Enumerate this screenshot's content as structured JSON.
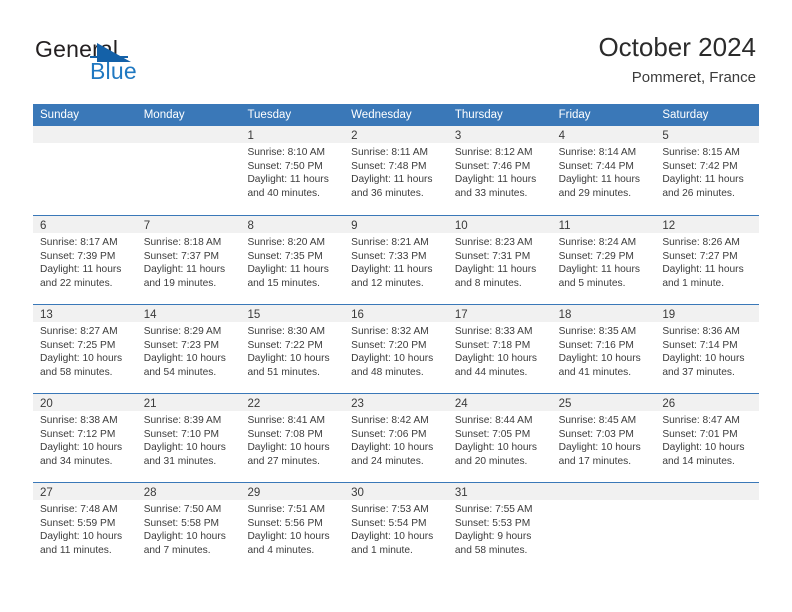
{
  "brand": {
    "name_part1": "General",
    "name_part2": "Blue",
    "accent_color": "#1f78c1",
    "triangle_color": "#1461a8"
  },
  "header": {
    "title": "October 2024",
    "subtitle": "Pommeret, France"
  },
  "calendar": {
    "header_bg": "#3a78b8",
    "weekdays": [
      "Sunday",
      "Monday",
      "Tuesday",
      "Wednesday",
      "Thursday",
      "Friday",
      "Saturday"
    ],
    "weeks": [
      [
        {
          "day": "",
          "lines": []
        },
        {
          "day": "",
          "lines": []
        },
        {
          "day": "1",
          "lines": [
            "Sunrise: 8:10 AM",
            "Sunset: 7:50 PM",
            "Daylight: 11 hours",
            "and 40 minutes."
          ]
        },
        {
          "day": "2",
          "lines": [
            "Sunrise: 8:11 AM",
            "Sunset: 7:48 PM",
            "Daylight: 11 hours",
            "and 36 minutes."
          ]
        },
        {
          "day": "3",
          "lines": [
            "Sunrise: 8:12 AM",
            "Sunset: 7:46 PM",
            "Daylight: 11 hours",
            "and 33 minutes."
          ]
        },
        {
          "day": "4",
          "lines": [
            "Sunrise: 8:14 AM",
            "Sunset: 7:44 PM",
            "Daylight: 11 hours",
            "and 29 minutes."
          ]
        },
        {
          "day": "5",
          "lines": [
            "Sunrise: 8:15 AM",
            "Sunset: 7:42 PM",
            "Daylight: 11 hours",
            "and 26 minutes."
          ]
        }
      ],
      [
        {
          "day": "6",
          "lines": [
            "Sunrise: 8:17 AM",
            "Sunset: 7:39 PM",
            "Daylight: 11 hours",
            "and 22 minutes."
          ]
        },
        {
          "day": "7",
          "lines": [
            "Sunrise: 8:18 AM",
            "Sunset: 7:37 PM",
            "Daylight: 11 hours",
            "and 19 minutes."
          ]
        },
        {
          "day": "8",
          "lines": [
            "Sunrise: 8:20 AM",
            "Sunset: 7:35 PM",
            "Daylight: 11 hours",
            "and 15 minutes."
          ]
        },
        {
          "day": "9",
          "lines": [
            "Sunrise: 8:21 AM",
            "Sunset: 7:33 PM",
            "Daylight: 11 hours",
            "and 12 minutes."
          ]
        },
        {
          "day": "10",
          "lines": [
            "Sunrise: 8:23 AM",
            "Sunset: 7:31 PM",
            "Daylight: 11 hours",
            "and 8 minutes."
          ]
        },
        {
          "day": "11",
          "lines": [
            "Sunrise: 8:24 AM",
            "Sunset: 7:29 PM",
            "Daylight: 11 hours",
            "and 5 minutes."
          ]
        },
        {
          "day": "12",
          "lines": [
            "Sunrise: 8:26 AM",
            "Sunset: 7:27 PM",
            "Daylight: 11 hours",
            "and 1 minute."
          ]
        }
      ],
      [
        {
          "day": "13",
          "lines": [
            "Sunrise: 8:27 AM",
            "Sunset: 7:25 PM",
            "Daylight: 10 hours",
            "and 58 minutes."
          ]
        },
        {
          "day": "14",
          "lines": [
            "Sunrise: 8:29 AM",
            "Sunset: 7:23 PM",
            "Daylight: 10 hours",
            "and 54 minutes."
          ]
        },
        {
          "day": "15",
          "lines": [
            "Sunrise: 8:30 AM",
            "Sunset: 7:22 PM",
            "Daylight: 10 hours",
            "and 51 minutes."
          ]
        },
        {
          "day": "16",
          "lines": [
            "Sunrise: 8:32 AM",
            "Sunset: 7:20 PM",
            "Daylight: 10 hours",
            "and 48 minutes."
          ]
        },
        {
          "day": "17",
          "lines": [
            "Sunrise: 8:33 AM",
            "Sunset: 7:18 PM",
            "Daylight: 10 hours",
            "and 44 minutes."
          ]
        },
        {
          "day": "18",
          "lines": [
            "Sunrise: 8:35 AM",
            "Sunset: 7:16 PM",
            "Daylight: 10 hours",
            "and 41 minutes."
          ]
        },
        {
          "day": "19",
          "lines": [
            "Sunrise: 8:36 AM",
            "Sunset: 7:14 PM",
            "Daylight: 10 hours",
            "and 37 minutes."
          ]
        }
      ],
      [
        {
          "day": "20",
          "lines": [
            "Sunrise: 8:38 AM",
            "Sunset: 7:12 PM",
            "Daylight: 10 hours",
            "and 34 minutes."
          ]
        },
        {
          "day": "21",
          "lines": [
            "Sunrise: 8:39 AM",
            "Sunset: 7:10 PM",
            "Daylight: 10 hours",
            "and 31 minutes."
          ]
        },
        {
          "day": "22",
          "lines": [
            "Sunrise: 8:41 AM",
            "Sunset: 7:08 PM",
            "Daylight: 10 hours",
            "and 27 minutes."
          ]
        },
        {
          "day": "23",
          "lines": [
            "Sunrise: 8:42 AM",
            "Sunset: 7:06 PM",
            "Daylight: 10 hours",
            "and 24 minutes."
          ]
        },
        {
          "day": "24",
          "lines": [
            "Sunrise: 8:44 AM",
            "Sunset: 7:05 PM",
            "Daylight: 10 hours",
            "and 20 minutes."
          ]
        },
        {
          "day": "25",
          "lines": [
            "Sunrise: 8:45 AM",
            "Sunset: 7:03 PM",
            "Daylight: 10 hours",
            "and 17 minutes."
          ]
        },
        {
          "day": "26",
          "lines": [
            "Sunrise: 8:47 AM",
            "Sunset: 7:01 PM",
            "Daylight: 10 hours",
            "and 14 minutes."
          ]
        }
      ],
      [
        {
          "day": "27",
          "lines": [
            "Sunrise: 7:48 AM",
            "Sunset: 5:59 PM",
            "Daylight: 10 hours",
            "and 11 minutes."
          ]
        },
        {
          "day": "28",
          "lines": [
            "Sunrise: 7:50 AM",
            "Sunset: 5:58 PM",
            "Daylight: 10 hours",
            "and 7 minutes."
          ]
        },
        {
          "day": "29",
          "lines": [
            "Sunrise: 7:51 AM",
            "Sunset: 5:56 PM",
            "Daylight: 10 hours",
            "and 4 minutes."
          ]
        },
        {
          "day": "30",
          "lines": [
            "Sunrise: 7:53 AM",
            "Sunset: 5:54 PM",
            "Daylight: 10 hours",
            "and 1 minute."
          ]
        },
        {
          "day": "31",
          "lines": [
            "Sunrise: 7:55 AM",
            "Sunset: 5:53 PM",
            "Daylight: 9 hours",
            "and 58 minutes."
          ]
        },
        {
          "day": "",
          "lines": []
        },
        {
          "day": "",
          "lines": []
        }
      ]
    ]
  }
}
